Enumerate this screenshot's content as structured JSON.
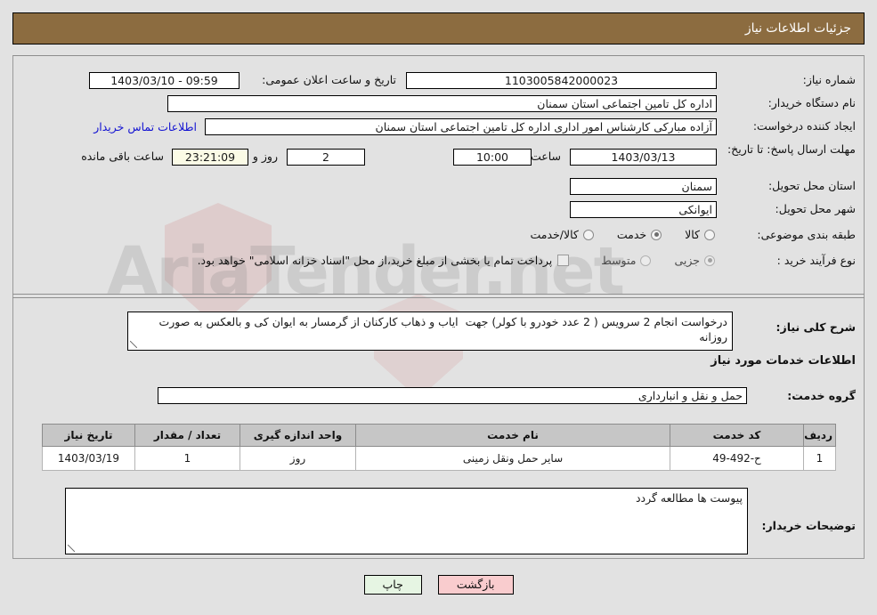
{
  "header": {
    "title": "جزئیات اطلاعات نیاز",
    "bar_color": "#8c6c40"
  },
  "form": {
    "need_number_label": "شماره نیاز:",
    "need_number_value": "1103005842000023",
    "public_announce_label": "تاریخ و ساعت اعلان عمومی:",
    "public_announce_value": "09:59 - 1403/03/10",
    "buyer_org_label": "نام دستگاه خریدار:",
    "buyer_org_value": "اداره کل تامین اجتماعی استان سمنان",
    "creator_label": "ایجاد کننده درخواست:",
    "creator_value": "آزاده مبارکی کارشناس امور اداری اداره کل تامین اجتماعی استان سمنان",
    "contact_link": "اطلاعات تماس خریدار",
    "deadline_label": "مهلت ارسال پاسخ: تا تاریخ:",
    "deadline_date": "1403/03/13",
    "deadline_hour_label": "ساعت",
    "deadline_hour_value": "10:00",
    "remaining_days_value": "2",
    "remaining_days_unit": "روز و",
    "remaining_time_value": "23:21:09",
    "remaining_time_unit": "ساعت باقی مانده",
    "province_label": "استان محل تحویل:",
    "province_value": "سمنان",
    "city_label": "شهر محل تحویل:",
    "city_value": "ایوانکی",
    "category_label": "طبقه بندی موضوعی:",
    "category_options": [
      {
        "label": "کالا",
        "selected": false
      },
      {
        "label": "خدمت",
        "selected": true
      },
      {
        "label": "کالا/خدمت",
        "selected": false
      }
    ],
    "process_label": "نوع فرآیند خرید :",
    "process_options": [
      {
        "label": "جزیی",
        "selected": true
      },
      {
        "label": "متوسط",
        "selected": false
      }
    ],
    "treasury_checkbox_checked": false,
    "treasury_text": "پرداخت تمام یا بخشی از مبلغ خرید،از محل \"اسناد خزانه اسلامی\" خواهد بود."
  },
  "description": {
    "label": "شرح کلی نیاز:",
    "value": "درخواست انجام 2 سرویس ( 2 عدد خودرو با کولر) جهت  ایاب و ذهاب کارکنان از گرمسار به ایوان کی و بالعکس به صورت روزانه"
  },
  "services": {
    "section_title": "اطلاعات خدمات مورد نیاز",
    "group_label": "گروه خدمت:",
    "group_value": "حمل و نقل و انبارداری",
    "columns": [
      "ردیف",
      "کد خدمت",
      "نام خدمت",
      "واحد اندازه گیری",
      "تعداد / مقدار",
      "تاریخ نیاز"
    ],
    "rows": [
      {
        "index": "1",
        "code": "ح-492-49",
        "name": "سایر حمل ونقل زمینی",
        "unit": "روز",
        "quantity": "1",
        "need_date": "1403/03/19"
      }
    ]
  },
  "buyer_notes": {
    "label": "توضیحات خریدار:",
    "value": "پیوست ها مطالعه گردد"
  },
  "actions": {
    "back_label": "بازگشت",
    "print_label": "چاپ"
  },
  "watermark": {
    "text": "AriaTender.net"
  }
}
